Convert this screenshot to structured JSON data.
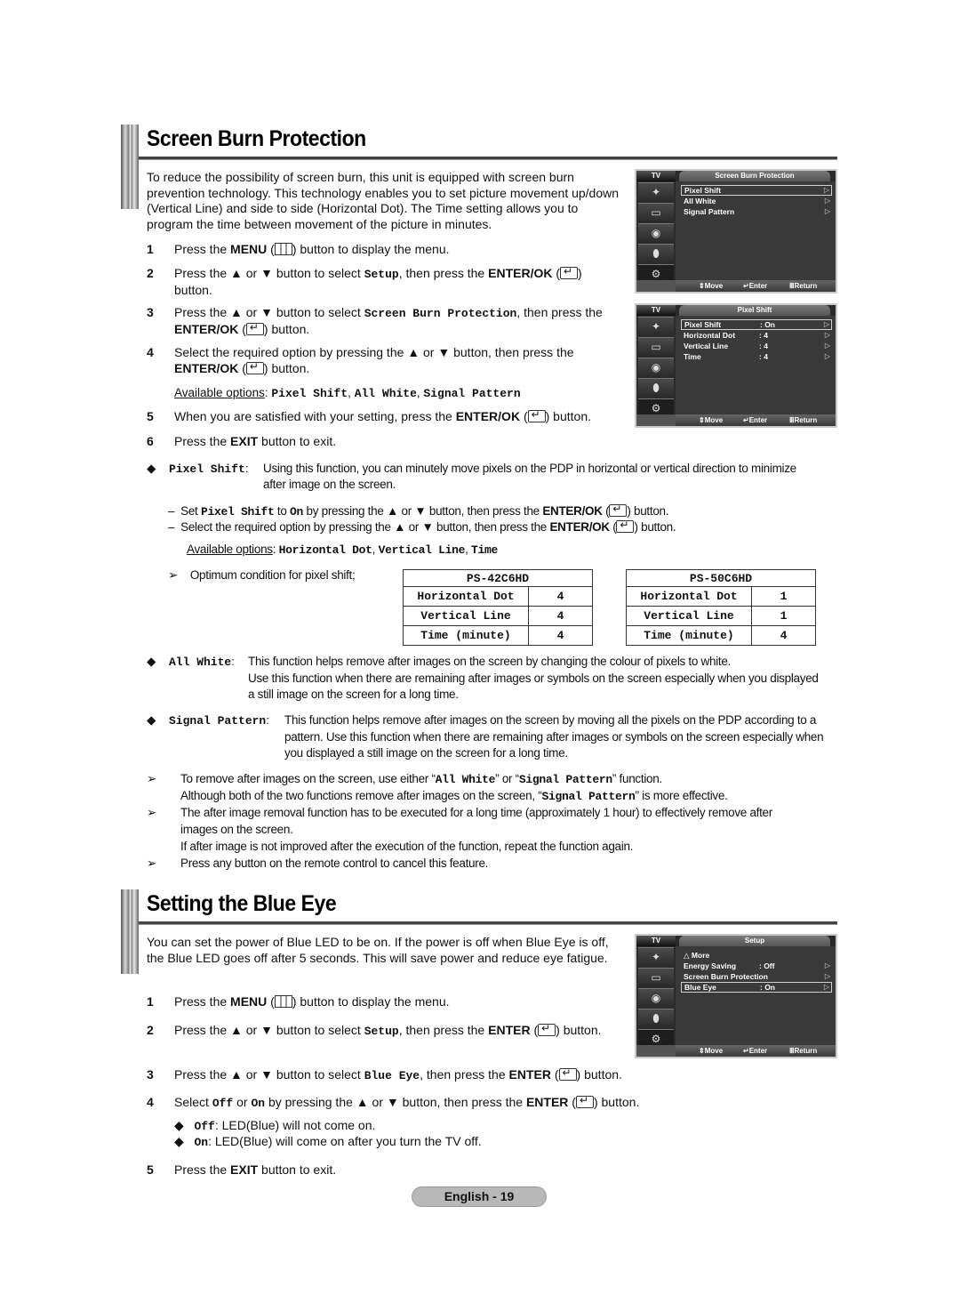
{
  "section1": {
    "title": "Screen Burn Protection",
    "intro": "To reduce the possibility of screen burn, this unit is equipped with screen burn prevention technology. This technology enables you to set picture movement up/down (Vertical Line) and side to side (Horizontal Dot). The Time setting allows you to program the time between movement of the picture in minutes.",
    "steps": [
      {
        "num": "1",
        "pre": "Press the ",
        "key": "MENU",
        "post": " button to display the menu."
      },
      {
        "num": "2",
        "pre": "Press the ▲ or ▼ button to select ",
        "code": "Setup",
        "mid": ", then press the ",
        "key": "ENTER/OK",
        "post": " button."
      },
      {
        "num": "3",
        "pre": "Press the ▲ or ▼ button to select ",
        "code": "Screen Burn Protection",
        "mid": ", then press the ",
        "key": "ENTER/OK",
        "post": " button."
      },
      {
        "num": "4",
        "pre": "Select the required option by pressing the ▲ or ▼ button, then press the ",
        "key": "ENTER/OK",
        "post": " button."
      },
      {
        "num": "5",
        "pre": "When you are satisfied with your setting, press the ",
        "key": "ENTER/OK",
        "post": " button."
      },
      {
        "num": "6",
        "pre": "Press the ",
        "key": "EXIT",
        "post": " button to exit."
      }
    ],
    "available_label": "Available options",
    "available_options": [
      "Pixel Shift",
      "All White",
      "Signal Pattern"
    ],
    "pixel_shift": {
      "term": "Pixel Shift",
      "desc": "Using this function, you can minutely move pixels on the PDP in horizontal or vertical direction to minimize after image on the screen.",
      "sub1_pre": "Set ",
      "sub1_code": "Pixel Shift",
      "sub1_to": " to ",
      "sub1_val": "On",
      "sub1_post": " by pressing the ▲ or ▼ button, then press the ",
      "sub1_key": "ENTER/OK",
      "sub1_end": " button.",
      "sub2_pre": "Select the required option by pressing the ▲ or ▼ button, then press the ",
      "sub2_key": "ENTER/OK",
      "sub2_end": " button.",
      "available_options": [
        "Horizontal Dot",
        "Vertical Line",
        "Time"
      ],
      "optimum_label": "Optimum condition for pixel shift;"
    },
    "tables": [
      {
        "model": "PS-42C6HD",
        "rows": [
          [
            "Horizontal Dot",
            "4"
          ],
          [
            "Vertical Line",
            "4"
          ],
          [
            "Time (minute)",
            "4"
          ]
        ]
      },
      {
        "model": "PS-50C6HD",
        "rows": [
          [
            "Horizontal Dot",
            "1"
          ],
          [
            "Vertical Line",
            "1"
          ],
          [
            "Time (minute)",
            "4"
          ]
        ]
      }
    ],
    "all_white": {
      "term": "All White",
      "desc1": "This function helps remove after images on the screen by changing the colour of pixels to white.",
      "desc2": "Use this function when there are remaining after images or symbols on the screen especially when you displayed a still image on the screen for a long time."
    },
    "signal_pattern": {
      "term": "Signal Pattern",
      "desc": "This function helps remove after images on the screen by moving all the pixels on the PDP according to a pattern. Use this function when there are remaining after images or symbols on the screen especially when you displayed a still image on the screen for a long time."
    },
    "notes": {
      "n1_a": "To remove after images on the screen, use either “",
      "n1_code1": "All White",
      "n1_b": "” or “",
      "n1_code2": "Signal Pattern",
      "n1_c": "” function.",
      "n1_line2_a": "Although both of the two functions remove after images on the screen, “",
      "n1_line2_code": "Signal Pattern",
      "n1_line2_b": "” is more effective.",
      "n2": "The after image removal function has to be executed for a long time (approximately 1 hour) to effectively remove after images on the screen.",
      "n2_line2": "If after image is not improved after the execution of the function, repeat the function again.",
      "n3": "Press any button on the remote control to cancel this feature."
    }
  },
  "osd_common": {
    "tv_label": "TV",
    "footer": {
      "move": "Move",
      "enter": "Enter",
      "return": "Return"
    }
  },
  "osd1": {
    "title": "Screen Burn Protection",
    "items": [
      {
        "label": "Pixel Shift",
        "value": "",
        "selected": true
      },
      {
        "label": "All White",
        "value": ""
      },
      {
        "label": "Signal Pattern",
        "value": ""
      }
    ]
  },
  "osd2": {
    "title": "Pixel Shift",
    "items": [
      {
        "label": "Pixel Shift",
        "value": ": On",
        "selected": true
      },
      {
        "label": "Horizontal Dot",
        "value": ": 4"
      },
      {
        "label": "Vertical Line",
        "value": ": 4"
      },
      {
        "label": "Time",
        "value": ": 4"
      }
    ]
  },
  "osd3": {
    "title": "Setup",
    "more": "More",
    "items": [
      {
        "label": "Energy Saving",
        "value": ": Off"
      },
      {
        "label": "Screen Burn Protection",
        "value": ""
      },
      {
        "label": "Blue Eye",
        "value": ": On",
        "selected": true
      }
    ]
  },
  "section2": {
    "title": "Setting the Blue Eye",
    "intro": "You can set the power of Blue LED to be on. If the power is off when Blue Eye is off, the Blue LED goes off after 5 seconds. This will save power and reduce eye fatigue.",
    "steps": [
      {
        "num": "1",
        "pre": "Press the ",
        "key": "MENU",
        "post": " button to display the menu."
      },
      {
        "num": "2",
        "pre": "Press the ▲ or ▼ button to select ",
        "code": "Setup",
        "mid": ", then press the ",
        "key": "ENTER",
        "post": " button."
      },
      {
        "num": "3",
        "pre": "Press the ▲ or ▼ button to select ",
        "code": "Blue Eye",
        "mid": ", then press the ",
        "key": "ENTER",
        "post": " button."
      },
      {
        "num": "4",
        "pre": "Select ",
        "code": "Off",
        "mid": " or ",
        "code2": "On",
        "mid2": " by pressing the ▲ or ▼ button, then press the ",
        "key": "ENTER",
        "post": " button."
      },
      {
        "num": "5",
        "pre": "Press the ",
        "key": "EXIT",
        "post": " button to exit."
      }
    ],
    "bullets": [
      {
        "code": "Off",
        "text": ": LED(Blue) will not come on."
      },
      {
        "code": "On",
        "text": ": LED(Blue) will come on after you turn the TV off."
      }
    ]
  },
  "footer": {
    "page_label": "English - 19"
  }
}
